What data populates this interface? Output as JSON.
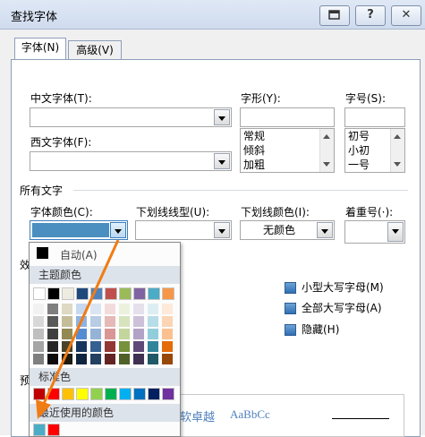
{
  "window": {
    "title": "查找字体",
    "restore_icon": "restore-icon",
    "help_label": "?",
    "close_label": "✕"
  },
  "tabs": {
    "font": "字体(N)",
    "advanced": "高级(V)"
  },
  "labels": {
    "chinese_font": "中文字体(T):",
    "western_font": "西文字体(F):",
    "font_style": "字形(Y):",
    "font_size": "字号(S):",
    "all_text": "所有文字",
    "font_color": "字体颜色(C):",
    "underline_type": "下划线线型(U):",
    "underline_color": "下划线颜色(I):",
    "emphasis": "着重号(·):",
    "effects_partial": "效",
    "preview_partial": "预"
  },
  "style_list": [
    "常规",
    "倾斜",
    "加粗"
  ],
  "size_list": [
    "初号",
    "小初",
    "一号"
  ],
  "underline_color_value": "无颜色",
  "effects": [
    {
      "label": "小型大写字母(M)",
      "checked": true
    },
    {
      "label": "全部大写字母(A)",
      "checked": true
    },
    {
      "label": "隐藏(H)",
      "checked": true
    }
  ],
  "color_popup": {
    "auto_label": "自动(A)",
    "theme_header": "主题颜色",
    "standard_header": "标准色",
    "recent_header": "最近使用的颜色",
    "theme_top": [
      "#ffffff",
      "#000000",
      "#eeece1",
      "#1f497d",
      "#4f81bd",
      "#c0504d",
      "#9bbb59",
      "#8064a2",
      "#4bacc6",
      "#f79646"
    ],
    "theme_shades": [
      [
        "#f2f2f2",
        "#7f7f7f",
        "#ddd9c3",
        "#c6d9f0",
        "#dbe5f1",
        "#f2dcdb",
        "#ebf1dd",
        "#e5e0ec",
        "#dbeef3",
        "#fdeada"
      ],
      [
        "#d8d8d8",
        "#595959",
        "#c4bd97",
        "#8db3e2",
        "#b8cce4",
        "#e5b9b7",
        "#d7e3bc",
        "#ccc1d9",
        "#b7dde8",
        "#fbd5b5"
      ],
      [
        "#bfbfbf",
        "#3f3f3f",
        "#938953",
        "#548dd4",
        "#95b3d7",
        "#d99694",
        "#c3d69b",
        "#b2a2c7",
        "#92cddc",
        "#fac08f"
      ],
      [
        "#a5a5a5",
        "#262626",
        "#494429",
        "#17365d",
        "#366092",
        "#953734",
        "#76923c",
        "#5f497a",
        "#31859b",
        "#e36c09"
      ],
      [
        "#7f7f7f",
        "#0c0c0c",
        "#1d1b10",
        "#0f243e",
        "#244061",
        "#632423",
        "#4f6128",
        "#3f3151",
        "#205867",
        "#974806"
      ]
    ],
    "standard": [
      "#c00000",
      "#ff0000",
      "#ffc000",
      "#ffff00",
      "#92d050",
      "#00b050",
      "#00b0f0",
      "#0070c0",
      "#002060",
      "#7030a0"
    ],
    "recent": [
      "#4bacc6",
      "#ff0000"
    ],
    "current_color": "#4a8fbf"
  },
  "preview": {
    "text1": "软卓越",
    "text2": "AaBbCc"
  },
  "colors": {
    "annotation_arrow": "#f07c14",
    "accent": "#3c7fc0"
  }
}
